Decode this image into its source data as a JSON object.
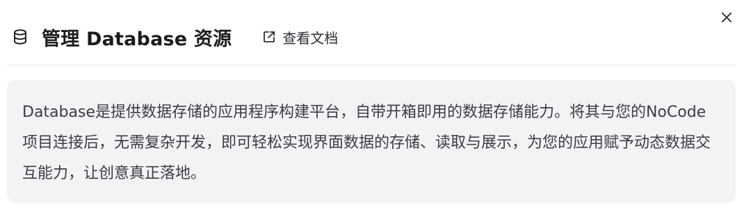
{
  "header": {
    "icon": "database-icon",
    "title": "管理 Database 资源",
    "doc_link_icon": "external-link-icon",
    "doc_link_label": "查看文档"
  },
  "close_icon": "close-icon",
  "description": "Database是提供数据存储的应用程序构建平台，自带开箱即用的数据存储能力。将其与您的NoCode 项目连接后，无需复杂开发，即可轻松实现界面数据的存储、读取与展示，为您的应用赋予动态数据交互能力，让创意真正落地。"
}
